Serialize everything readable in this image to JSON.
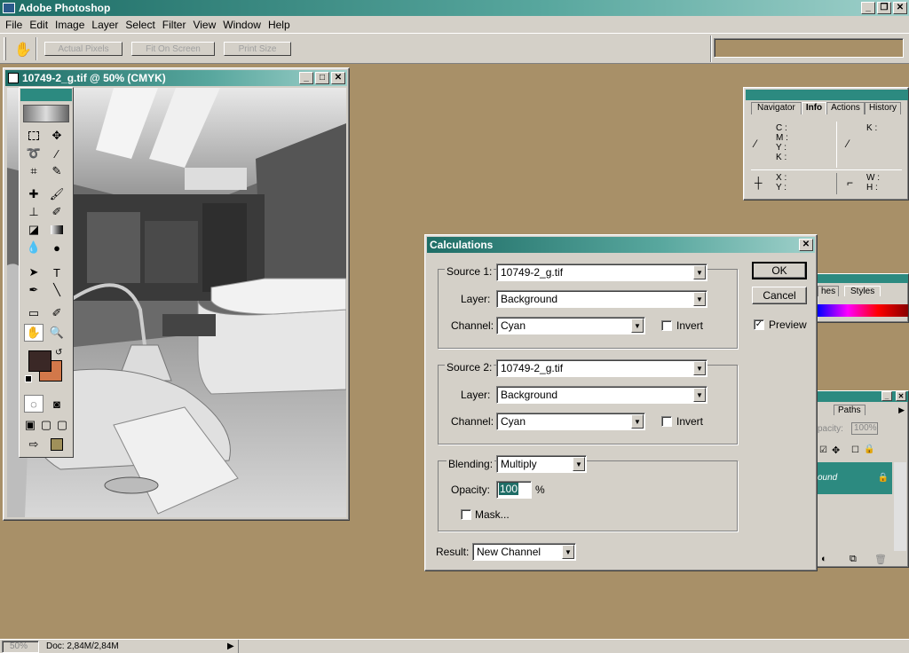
{
  "app": {
    "title": "Adobe Photoshop"
  },
  "menu": [
    "File",
    "Edit",
    "Image",
    "Layer",
    "Select",
    "Filter",
    "View",
    "Window",
    "Help"
  ],
  "options_bar": {
    "actual_pixels": "Actual Pixels",
    "fit_on_screen": "Fit On Screen",
    "print_size": "Print Size"
  },
  "document": {
    "title": "10749-2_g.tif @ 50% (CMYK)"
  },
  "info_panel": {
    "tabs": [
      "Navigator",
      "Info",
      "Actions",
      "History"
    ],
    "cmyk_labels": "C :\nM :\nY :\nK :",
    "k_label": "K :",
    "xy_labels": "X :\nY :",
    "wh_labels": "W :\nH :"
  },
  "swatches_panel": {
    "tab": "Styles",
    "partial_tab": "hes"
  },
  "layers_panel": {
    "tab": "Paths",
    "opacity_label": "pacity:",
    "opacity_value": "100%",
    "layer_name": "ound"
  },
  "calculations": {
    "title": "Calculations",
    "source1_label": "Source 1:",
    "source1_value": "10749-2_g.tif",
    "layer1_label": "Layer:",
    "layer1_value": "Background",
    "channel1_label": "Channel:",
    "channel1_value": "Cyan",
    "invert1_label": "Invert",
    "source2_label": "Source 2:",
    "source2_value": "10749-2_g.tif",
    "layer2_label": "Layer:",
    "layer2_value": "Background",
    "channel2_label": "Channel:",
    "channel2_value": "Cyan",
    "invert2_label": "Invert",
    "blending_label": "Blending:",
    "blending_value": "Multiply",
    "opacity_label": "Opacity:",
    "opacity_value": "100",
    "opacity_unit": "%",
    "mask_label": "Mask...",
    "result_label": "Result:",
    "result_value": "New Channel",
    "ok_label": "OK",
    "cancel_label": "Cancel",
    "preview_label": "Preview"
  },
  "status": {
    "zoom": "50%",
    "doc": "Doc: 2,84M/2,84M"
  },
  "colors": {
    "foreground": "#3a2826",
    "background": "#d2784a",
    "desktop": "#a89068"
  }
}
